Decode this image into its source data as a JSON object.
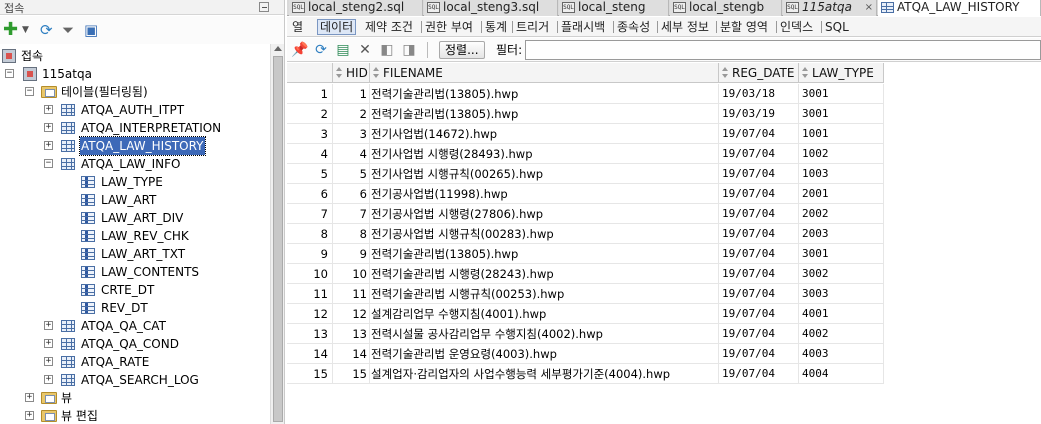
{
  "left_panel": {
    "title": "접속",
    "tree": {
      "connections_label": "접속",
      "connection_name": "115atqa",
      "tables_folder": "테이블(필터링됨)",
      "tables": [
        {
          "name": "ATQA_AUTH_ITPT"
        },
        {
          "name": "ATQA_INTERPRETATION"
        },
        {
          "name": "ATQA_LAW_HISTORY"
        },
        {
          "name": "ATQA_LAW_INFO"
        },
        {
          "name": "ATQA_QA_CAT"
        },
        {
          "name": "ATQA_QA_COND"
        },
        {
          "name": "ATQA_RATE"
        },
        {
          "name": "ATQA_SEARCH_LOG"
        }
      ],
      "law_info_columns": [
        "LAW_TYPE",
        "LAW_ART",
        "LAW_ART_DIV",
        "LAW_REV_CHK",
        "LAW_ART_TXT",
        "LAW_CONTENTS",
        "CRTE_DT",
        "REV_DT"
      ],
      "views_folder": "뷰",
      "editing_views_folder": "뷰 편집"
    }
  },
  "editor": {
    "tabs": [
      {
        "label": "local_steng2.sql",
        "icon": "sql-icon"
      },
      {
        "label": "local_steng3.sql",
        "icon": "sql-icon"
      },
      {
        "label": "local_steng",
        "icon": "sql-icon"
      },
      {
        "label": "local_stengb",
        "icon": "sql-icon"
      },
      {
        "label": "115atqa",
        "icon": "sql-icon"
      },
      {
        "label": "ATQA_LAW_HISTORY",
        "icon": "table-icon"
      }
    ],
    "subtabs": [
      "열",
      "데이터",
      "제약 조건",
      "권한 부여",
      "통계",
      "트리거",
      "플래시백",
      "종속성",
      "세부 정보",
      "분할 영역",
      "인덱스",
      "SQL"
    ],
    "active_subtab": "데이터",
    "actions": {
      "sort_label": "정렬...",
      "filter_label": "필터:",
      "filter_value": ""
    },
    "grid": {
      "columns": [
        "HID",
        "FILENAME",
        "REG_DATE",
        "LAW_TYPE"
      ],
      "rows": [
        {
          "n": "1",
          "hid": "1",
          "filename": "전력기술관리법(13805).hwp",
          "reg_date": "19/03/18",
          "law_type": "3001"
        },
        {
          "n": "2",
          "hid": "2",
          "filename": "전력기술관리법(13805).hwp",
          "reg_date": "19/03/19",
          "law_type": "3001"
        },
        {
          "n": "3",
          "hid": "3",
          "filename": "전기사업법(14672).hwp",
          "reg_date": "19/07/04",
          "law_type": "1001"
        },
        {
          "n": "4",
          "hid": "4",
          "filename": "전기사업법 시행령(28493).hwp",
          "reg_date": "19/07/04",
          "law_type": "1002"
        },
        {
          "n": "5",
          "hid": "5",
          "filename": "전기사업법 시행규칙(00265).hwp",
          "reg_date": "19/07/04",
          "law_type": "1003"
        },
        {
          "n": "6",
          "hid": "6",
          "filename": "전기공사업법(11998).hwp",
          "reg_date": "19/07/04",
          "law_type": "2001"
        },
        {
          "n": "7",
          "hid": "7",
          "filename": "전기공사업법 시행령(27806).hwp",
          "reg_date": "19/07/04",
          "law_type": "2002"
        },
        {
          "n": "8",
          "hid": "8",
          "filename": "전기공사업법 시행규칙(00283).hwp",
          "reg_date": "19/07/04",
          "law_type": "2003"
        },
        {
          "n": "9",
          "hid": "9",
          "filename": "전력기술관리법(13805).hwp",
          "reg_date": "19/07/04",
          "law_type": "3001"
        },
        {
          "n": "10",
          "hid": "10",
          "filename": "전력기술관리법 시행령(28243).hwp",
          "reg_date": "19/07/04",
          "law_type": "3002"
        },
        {
          "n": "11",
          "hid": "11",
          "filename": "전력기술관리법 시행규칙(00253).hwp",
          "reg_date": "19/07/04",
          "law_type": "3003"
        },
        {
          "n": "12",
          "hid": "12",
          "filename": "설계감리업무 수행지침(4001).hwp",
          "reg_date": "19/07/04",
          "law_type": "4001"
        },
        {
          "n": "13",
          "hid": "13",
          "filename": "전력시설물 공사감리업무 수행지침(4002).hwp",
          "reg_date": "19/07/04",
          "law_type": "4002"
        },
        {
          "n": "14",
          "hid": "14",
          "filename": "전력기술관리법 운영요령(4003).hwp",
          "reg_date": "19/07/04",
          "law_type": "4003"
        },
        {
          "n": "15",
          "hid": "15",
          "filename": "설계업자·감리업자의 사업수행능력 세부평가기준(4004).hwp",
          "reg_date": "19/07/04",
          "law_type": "4004"
        }
      ]
    }
  },
  "colors": {
    "selection": "#3d69b8",
    "active_subtab_bg": "#dde7f6",
    "tab_bar": "#d9d9d9"
  }
}
